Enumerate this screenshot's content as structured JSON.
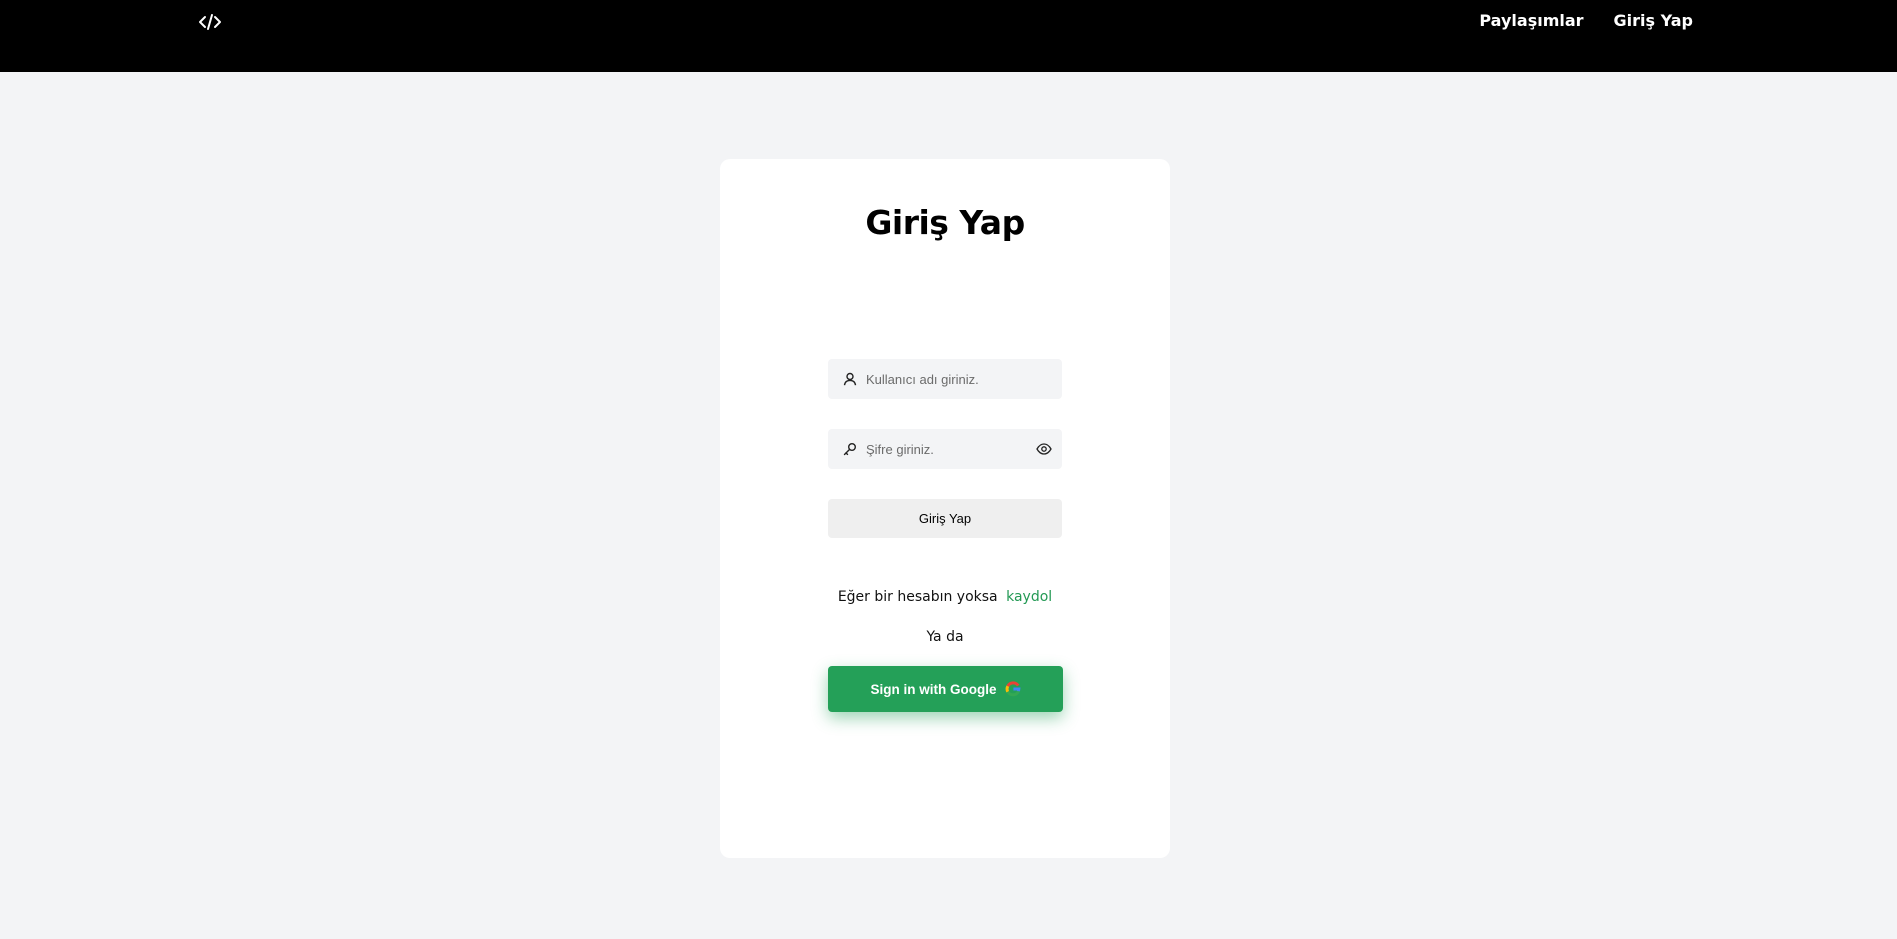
{
  "navbar": {
    "logo_icon": "code-icon",
    "links": [
      "Paylaşımlar",
      "Giriş Yap"
    ]
  },
  "login": {
    "title": "Giriş Yap",
    "username": {
      "icon": "user-icon",
      "placeholder": "Kullanıcı adı giriniz.",
      "value": ""
    },
    "password": {
      "icon": "key-icon",
      "placeholder": "Şifre giriniz.",
      "value": "",
      "toggle_icon": "eye-icon"
    },
    "submit_label": "Giriş Yap",
    "signup_prompt": "Eğer bir hesabın yoksa",
    "signup_link": "kaydol",
    "or_text": "Ya da",
    "google_label": "Sign in with Google",
    "google_icon": "google-icon"
  },
  "colors": {
    "navbar_bg": "#000000",
    "page_bg": "#f3f4f6",
    "card_bg": "#ffffff",
    "accent_green": "#24a058",
    "link_green": "#239954"
  }
}
